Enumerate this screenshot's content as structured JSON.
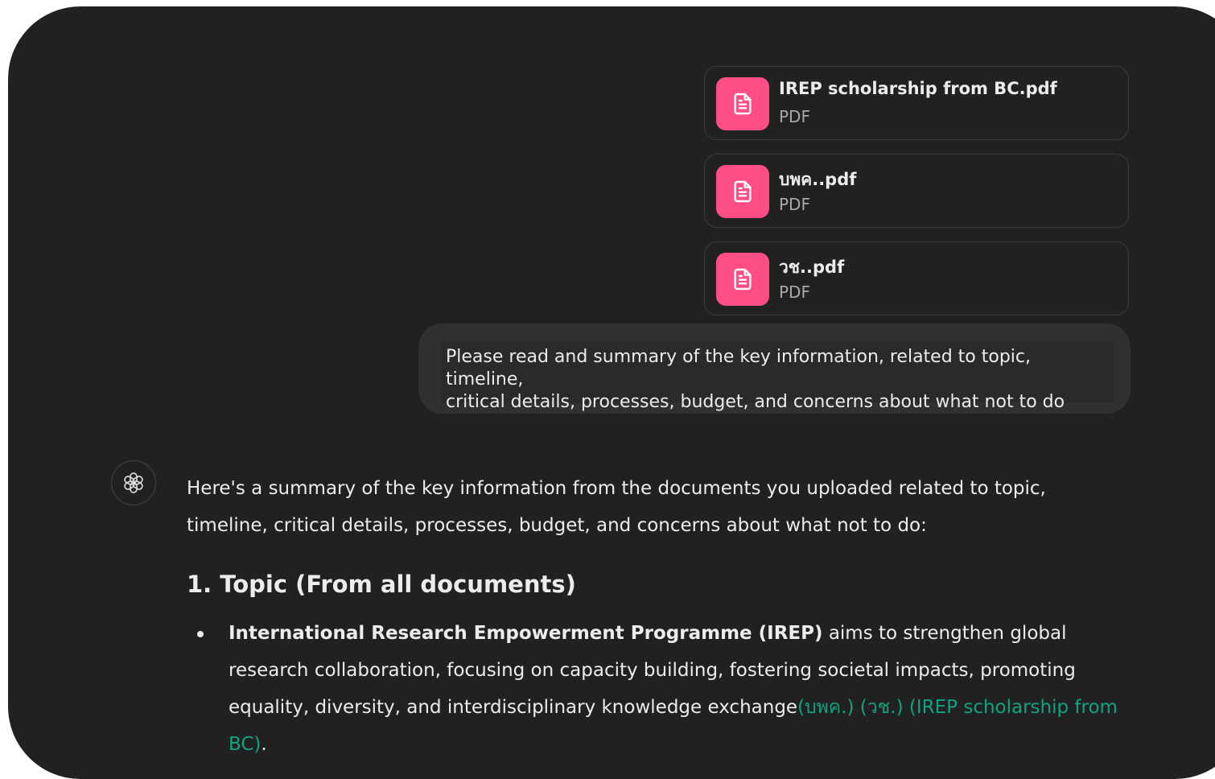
{
  "attachments": [
    {
      "name": "IREP scholarship from BC.pdf",
      "type": "PDF",
      "icon": "document-icon"
    },
    {
      "name": "บพค..pdf",
      "type": "PDF",
      "icon": "document-icon"
    },
    {
      "name": "วช..pdf",
      "type": "PDF",
      "icon": "document-icon"
    }
  ],
  "user_message": {
    "line1": "Please read and summary of the key information, related to topic, timeline,",
    "line2": "critical details, processes, budget, and concerns about what not to do"
  },
  "assistant": {
    "avatar_icon": "openai-logo-icon",
    "intro": "Here's a summary of the key information from the documents you uploaded related to topic, timeline, critical details, processes, budget, and concerns about what not to do:",
    "section_heading": "1. Topic (From all documents)",
    "bullets": [
      {
        "bold": "International Research Empowerment Programme (IREP)",
        "text": " aims to strengthen global research collaboration, focusing on capacity building, fostering societal impacts, promoting equality, diversity, and interdisciplinary knowledge exchange",
        "citation": "(บพค.) (วช.) (IREP scholarship from BC)",
        "end": "."
      }
    ]
  },
  "colors": {
    "background": "#212121",
    "bubble": "#303030",
    "file_icon_bg": "#ff4d86",
    "citation": "#10a37f",
    "text": "#ececec"
  }
}
